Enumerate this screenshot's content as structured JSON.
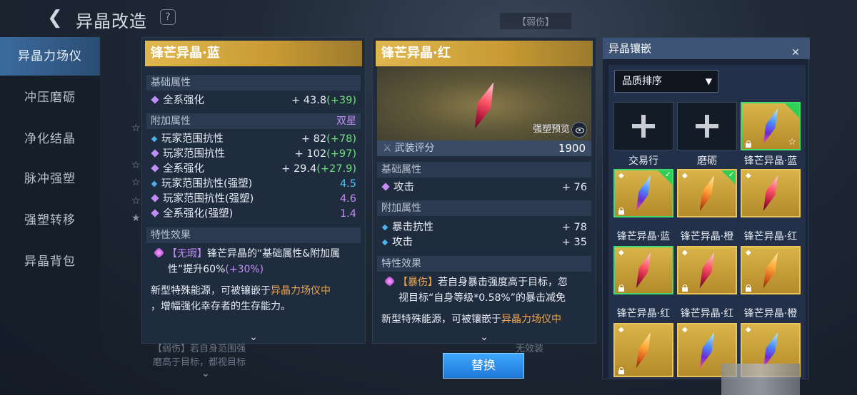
{
  "header": {
    "back_glyph": "❮",
    "title": "异晶改造",
    "help_glyph": "?",
    "bg_tag": "【弱伤】"
  },
  "sidebar": {
    "items": [
      {
        "label": "异晶力场仪",
        "active": true
      },
      {
        "label": "冲压磨砺",
        "active": false
      },
      {
        "label": "净化结晶",
        "active": false
      },
      {
        "label": "脉冲强塑",
        "active": false
      },
      {
        "label": "强塑转移",
        "active": false
      },
      {
        "label": "异晶背包",
        "active": false
      }
    ]
  },
  "background": {
    "star_glyph": "☆",
    "star_filled_glyph": "★",
    "bottom_text": "【弱伤】若自身范围强",
    "bottom_text2": "磨高于目标，都视目标",
    "bottom_right": "无效装",
    "bottom_chevron": "⌄"
  },
  "left_panel": {
    "title": "锋芒异晶·蓝",
    "base_header": "基础属性",
    "base_rows": [
      {
        "label": "全系强化",
        "value": "+ 43.8",
        "bonus": "(+39)",
        "icon": "purple"
      }
    ],
    "extra_header": "附加属性",
    "extra_tag": "双星",
    "extra_rows": [
      {
        "label": "玩家范围抗性",
        "value": "+ 82",
        "bonus": "(+78)",
        "icon": "blue"
      },
      {
        "label": "玩家范围抗性",
        "value": "+ 102",
        "bonus": "(+97)",
        "icon": "purple"
      },
      {
        "label": "全系强化",
        "value": "+ 29.4",
        "bonus": "(+27.9)",
        "icon": "purple"
      },
      {
        "label": "玩家范围抗性(强塑)",
        "value": "4.5",
        "bonus": "",
        "icon": "blue",
        "color": "blue"
      },
      {
        "label": "玩家范围抗性(强塑)",
        "value": "4.6",
        "bonus": "",
        "icon": "purple",
        "color": "purple"
      },
      {
        "label": "全系强化(强塑)",
        "value": "1.4",
        "bonus": "",
        "icon": "purple",
        "color": "purple"
      }
    ],
    "trait_header": "特性效果",
    "trait_name": "【无瑕】",
    "trait_text_1": "锋芒异晶的“基础属性&附加属",
    "trait_text_2": "性”提升60%",
    "trait_bonus": "(+30%)",
    "desc_1": "新型特殊能源，可被镶嵌于",
    "desc_link": "异晶力场仪中",
    "desc_2": "，增幅强化幸存者的生存能力。",
    "chevron": "⌄"
  },
  "right_panel": {
    "title": "锋芒异晶·红",
    "preview_label": "强塑预览",
    "score_label": "武装评分",
    "score_value": "1900",
    "swords_glyph": "⚔",
    "base_header": "基础属性",
    "base_rows": [
      {
        "label": "攻击",
        "value": "+ 76",
        "icon": "purple"
      }
    ],
    "extra_header": "附加属性",
    "extra_rows": [
      {
        "label": "暴击抗性",
        "value": "+ 78",
        "icon": "blue"
      },
      {
        "label": "攻击",
        "value": "+ 35",
        "icon": "blue"
      }
    ],
    "trait_header": "特性效果",
    "trait_name": "【暴伤】",
    "trait_text_1": "若自身暴击强度高于目标，忽",
    "trait_text_2": "视目标“自身等级*0.58%”的暴击减免",
    "desc_1": "新型特殊能源，可被镶嵌于",
    "desc_link": "异晶力场仪中",
    "chevron": "⌄"
  },
  "replace_button": "替换",
  "inventory": {
    "title": "异晶镶嵌",
    "collapse_glyph": "✕",
    "sort_label": "品质排序",
    "sort_chevron": "▼",
    "slots": [
      {
        "label": "交易行",
        "kind": "plus"
      },
      {
        "label": "磨砺",
        "kind": "plus"
      },
      {
        "label": "锋芒异晶·蓝",
        "kind": "crystal",
        "color": "blue"
      },
      {
        "label": "锋芒异晶·蓝",
        "kind": "crystal",
        "color": "blue"
      },
      {
        "label": "锋芒异晶·橙",
        "kind": "crystal",
        "color": "orange"
      },
      {
        "label": "锋芒异晶·红",
        "kind": "crystal",
        "color": "red"
      },
      {
        "label": "锋芒异晶·红",
        "kind": "crystal",
        "color": "red"
      },
      {
        "label": "锋芒异晶·红",
        "kind": "crystal",
        "color": "red"
      },
      {
        "label": "锋芒异晶·橙",
        "kind": "crystal",
        "color": "orange"
      },
      {
        "label": "",
        "kind": "crystal",
        "color": "orange"
      },
      {
        "label": "",
        "kind": "crystal",
        "color": "blue"
      },
      {
        "label": "",
        "kind": "crystal",
        "color": "blue"
      }
    ],
    "star_glyph": "☆",
    "check_glyph": "✓",
    "gem_glyph": "◆"
  },
  "colors": {
    "accent_gold": "#d9b449",
    "accent_blue": "#3ea7ff",
    "bonus_green": "#6ee27a",
    "strong_purple": "#c58df7",
    "strong_blue": "#58c0ff",
    "link_orange": "#f0a64e"
  }
}
